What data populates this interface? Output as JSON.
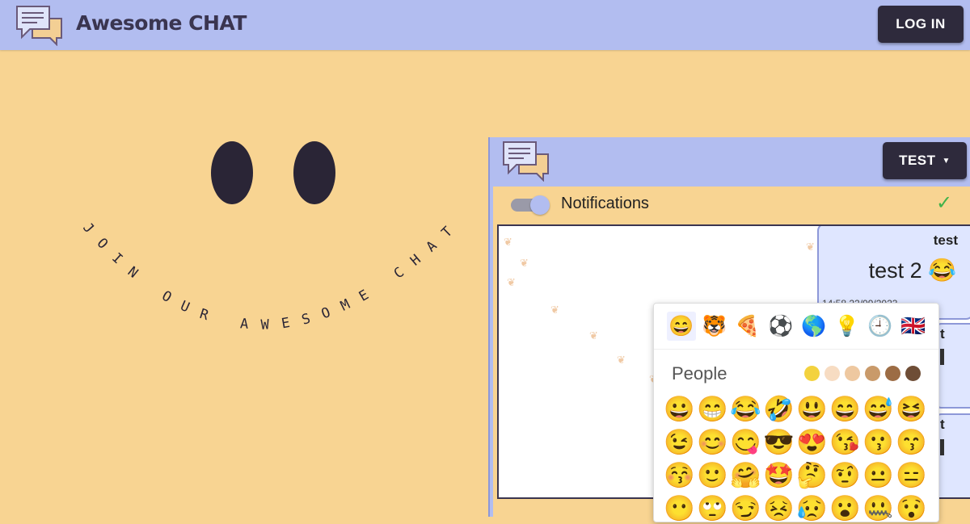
{
  "header": {
    "brand": "Awesome CHAT",
    "login_label": "LOG IN"
  },
  "hero": {
    "arc_text": "JOIN OUR AWESOME CHAT"
  },
  "widget": {
    "user_button": "TEST",
    "notifications_label": "Notifications",
    "notifications_enabled": true,
    "status_icon": "check-icon",
    "messages": [
      {
        "user": "test",
        "text": "test 2",
        "emoji": "😂",
        "time": "14:58 22/09/2023"
      },
      {
        "user": "t",
        "text": "",
        "emoji": "",
        "time": ""
      },
      {
        "user": "t",
        "text": "",
        "emoji": "",
        "time": ""
      }
    ]
  },
  "emoji_picker": {
    "tabs": [
      {
        "name": "people-tab",
        "glyph": "😄"
      },
      {
        "name": "nature-tab",
        "glyph": "🐯"
      },
      {
        "name": "food-tab",
        "glyph": "🍕"
      },
      {
        "name": "activity-tab",
        "glyph": "⚽"
      },
      {
        "name": "travel-tab",
        "glyph": "🌎"
      },
      {
        "name": "objects-tab",
        "glyph": "💡"
      },
      {
        "name": "symbols-tab",
        "glyph": "🕘"
      },
      {
        "name": "flags-tab",
        "glyph": "🇬🇧"
      }
    ],
    "category": "People",
    "skin_tones": [
      "#f3d23e",
      "#f7dcc2",
      "#eec8a0",
      "#c99a6a",
      "#9c6c44",
      "#6e4d36"
    ],
    "emojis": [
      [
        "😀",
        "😁",
        "😂",
        "🤣",
        "😃",
        "😄",
        "😅",
        "😆"
      ],
      [
        "😉",
        "😊",
        "😋",
        "😎",
        "😍",
        "😘",
        "😗",
        "😙"
      ],
      [
        "😚",
        "🙂",
        "🤗",
        "🤩",
        "🤔",
        "🤨",
        "😐",
        "😑"
      ],
      [
        "😶",
        "🙄",
        "😏",
        "😣",
        "😥",
        "😮",
        "🤐",
        "😯"
      ]
    ]
  },
  "colors": {
    "background": "#f8d492",
    "bar": "#b2bdf0",
    "button": "#2e2a3c",
    "bubble": "#dfe6ff"
  }
}
